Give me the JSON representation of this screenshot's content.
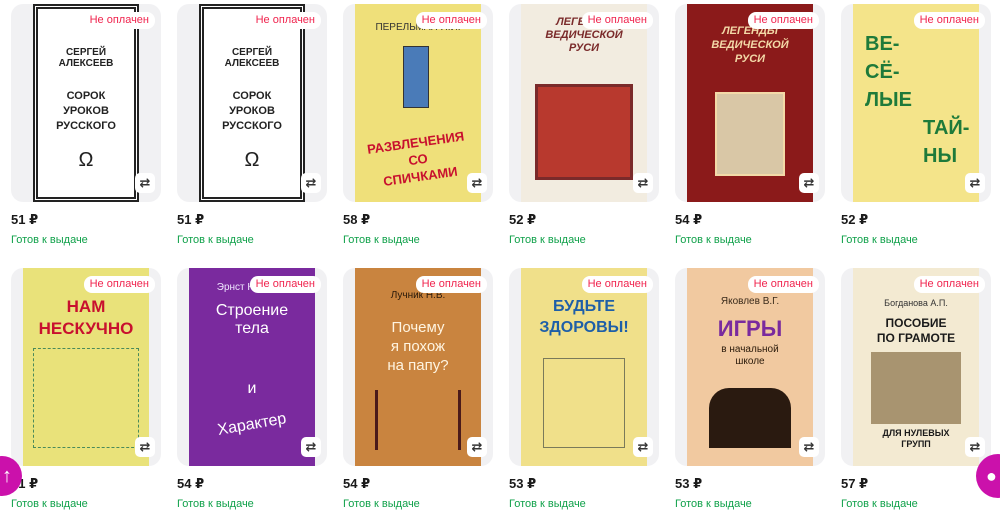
{
  "products": [
    {
      "title_lines": [
        "СЕРГЕЙ",
        "АЛЕКСЕЕВ",
        "СОРОК",
        "УРОКОВ",
        "РУССКОГО"
      ],
      "badge": "Не оплачен",
      "price": "51 ₽",
      "status": "Готов к выдаче"
    },
    {
      "title_lines": [
        "СЕРГЕЙ",
        "АЛЕКСЕЕВ",
        "СОРОК",
        "УРОКОВ",
        "РУССКОГО"
      ],
      "badge": "Не оплачен",
      "price": "51 ₽",
      "status": "Готов к выдаче"
    },
    {
      "author": "ПЕРЕЛЬМАН Я.И.",
      "title_lines": [
        "РАЗВЛЕЧЕНИЯ",
        "СО",
        "СПИЧКАМИ"
      ],
      "badge": "Не оплачен",
      "price": "58 ₽",
      "status": "Готов к выдаче"
    },
    {
      "title_lines": [
        "ЛЕГЕНДЫ",
        "ВЕДИЧЕСКОЙ",
        "РУСИ"
      ],
      "badge": "Не оплачен",
      "price": "52 ₽",
      "status": "Готов к выдаче"
    },
    {
      "title_lines": [
        "ЛЕГЕНДЫ",
        "ВЕДИЧЕСКОЙ",
        "РУСИ"
      ],
      "badge": "Не оплачен",
      "price": "54 ₽",
      "status": "Готов к выдаче"
    },
    {
      "title_lines": [
        "ВЕ-",
        "СЁ-",
        "ЛЫЕ",
        "ТАЙ-",
        "НЫ"
      ],
      "badge": "Не оплачен",
      "price": "52 ₽",
      "status": "Готов к выдаче"
    },
    {
      "title_lines": [
        "НАМ",
        "НЕСКУЧНО"
      ],
      "badge": "Не оплачен",
      "price": "51 ₽",
      "status": "Готов к выдаче"
    },
    {
      "author": "Эрнст Кречмер",
      "title_lines": [
        "Строение",
        "тела",
        "и",
        "Характер"
      ],
      "badge": "Не оплачен",
      "price": "54 ₽",
      "status": "Готов к выдаче"
    },
    {
      "author": "Лучник Н.В.",
      "title_lines": [
        "Почему",
        "я похож",
        "на папу?"
      ],
      "badge": "Не оплачен",
      "price": "54 ₽",
      "status": "Готов к выдаче"
    },
    {
      "title_lines": [
        "БУДЬТЕ",
        "ЗДОРОВЫ!"
      ],
      "badge": "Не оплачен",
      "price": "53 ₽",
      "status": "Готов к выдаче"
    },
    {
      "author": "Яковлев В.Г.",
      "title_lines": [
        "ИГРЫ",
        "в начальной",
        "школе"
      ],
      "badge": "Не оплачен",
      "price": "53 ₽",
      "status": "Готов к выдаче"
    },
    {
      "author": "Богданова А.П.",
      "title_lines": [
        "ПОСОБИЕ",
        "ПО ГРАМОТЕ",
        "ДЛЯ НУЛЕВЫХ",
        "ГРУПП"
      ],
      "badge": "Не оплачен",
      "price": "57 ₽",
      "status": "Готов к выдаче"
    }
  ],
  "icons": {
    "swap": "swap-arrows-icon",
    "scroll_up": "arrow-up-icon",
    "chat": "chat-bubble-icon"
  },
  "colors": {
    "badge_text": "#f0244e",
    "status_text": "#10a14a",
    "accent": "#cb11ab"
  }
}
